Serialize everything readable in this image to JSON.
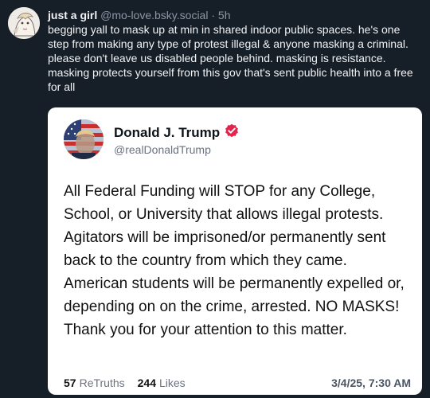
{
  "post": {
    "display_name": "just a girl",
    "handle": "@mo-love.bsky.social",
    "separator": "·",
    "time": "5h",
    "text": "begging yall to mask up at min in shared indoor public spaces. he's one step from making any type of protest illegal & anyone masking a criminal. please don't leave us disabled people behind. masking is resistance. masking protects yourself from this gov that's sent public health into a free for all"
  },
  "quoted": {
    "name": "Donald J. Trump",
    "handle": "@realDonaldTrump",
    "verified_icon": "verified-badge-icon",
    "verified_color": "#e6234b",
    "body": "All Federal Funding will STOP for any College, School, or University that allows illegal protests. Agitators will be imprisoned/or permanently sent back to the country from which they came. American students will be permanently expelled or, depending on on the crime, arrested. NO MASKS! Thank you for your attention to this matter.",
    "retruths_count": "57",
    "retruths_label": "ReTruths",
    "likes_count": "244",
    "likes_label": "Likes",
    "date": "3/4/25, 7:30 AM"
  }
}
